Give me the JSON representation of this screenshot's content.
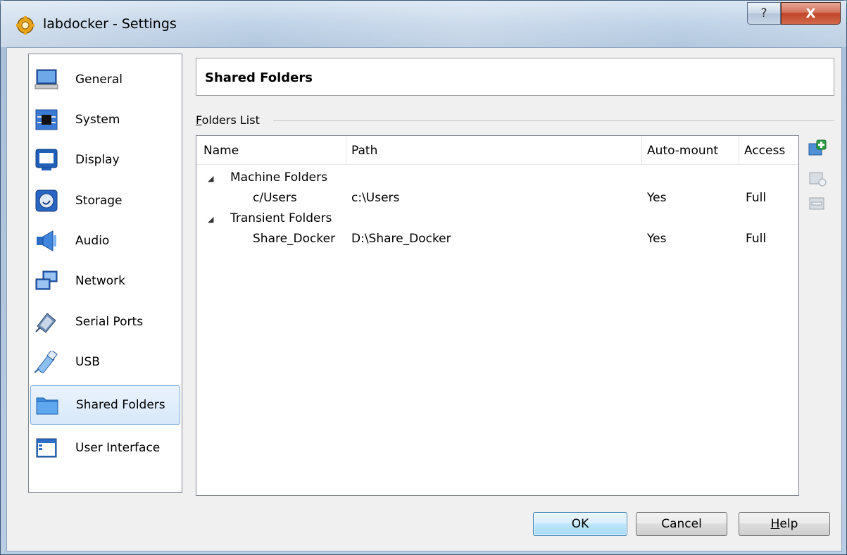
{
  "window": {
    "title": "labdocker - Settings",
    "help_glyph": "?",
    "close_glyph": "X"
  },
  "sidebar": {
    "items": [
      {
        "label": "General",
        "icon": "monitor-icon"
      },
      {
        "label": "System",
        "icon": "chip-icon"
      },
      {
        "label": "Display",
        "icon": "display-icon"
      },
      {
        "label": "Storage",
        "icon": "disk-icon"
      },
      {
        "label": "Audio",
        "icon": "speaker-icon"
      },
      {
        "label": "Network",
        "icon": "network-icon"
      },
      {
        "label": "Serial Ports",
        "icon": "serial-port-icon"
      },
      {
        "label": "USB",
        "icon": "usb-icon"
      },
      {
        "label": "Shared Folders",
        "icon": "folder-icon",
        "selected": true
      },
      {
        "label": "User Interface",
        "icon": "window-icon"
      }
    ]
  },
  "main": {
    "section_title": "Shared Folders",
    "group_label": "Folders List",
    "group_label_mnemonic": "F",
    "group_label_rest": "olders List",
    "columns": [
      "Name",
      "Path",
      "Auto-mount",
      "Access"
    ],
    "groups": [
      {
        "label": "Machine Folders",
        "rows": [
          {
            "name": "c/Users",
            "path": "c:\\Users",
            "auto_mount": "Yes",
            "access": "Full"
          }
        ]
      },
      {
        "label": "Transient Folders",
        "rows": [
          {
            "name": "Share_Docker",
            "path": "D:\\Share_Docker",
            "auto_mount": "Yes",
            "access": "Full"
          }
        ]
      }
    ],
    "tools": [
      "add-folder-icon",
      "edit-folder-icon",
      "remove-folder-icon"
    ]
  },
  "buttons": {
    "ok": "OK",
    "cancel": "Cancel",
    "help": "Help",
    "help_mnemonic": "H",
    "help_rest": "elp"
  },
  "colors": {
    "selection_bg": "#d7e8fa",
    "selection_border": "#84acdd",
    "close_red": "#c0442a",
    "default_button": "#bee6fd"
  }
}
